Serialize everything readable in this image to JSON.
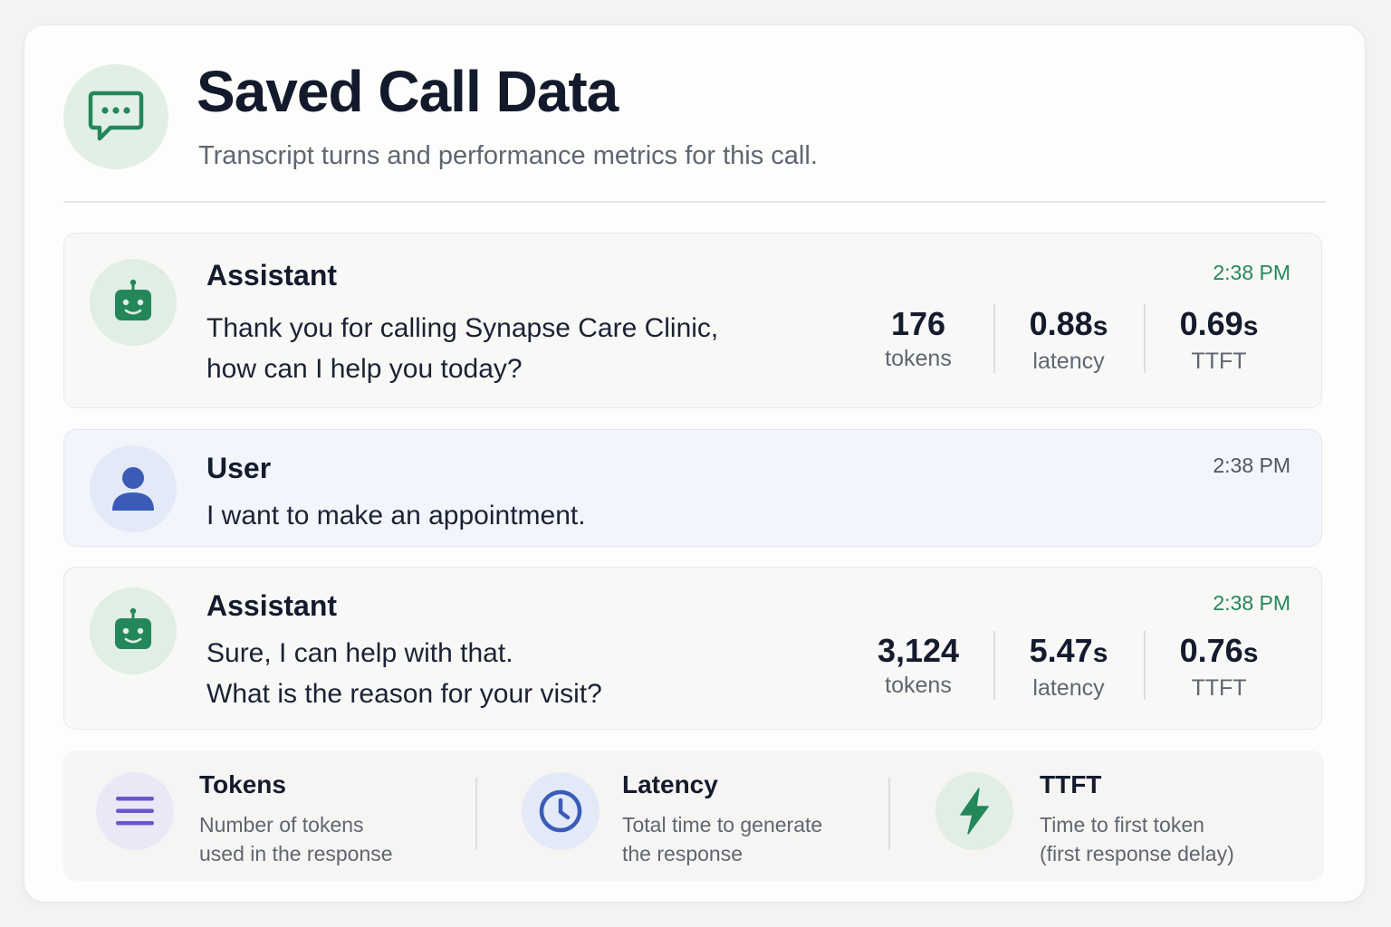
{
  "header": {
    "title": "Saved Call Data",
    "subtitle": "Transcript turns and performance metrics for this call.",
    "icon": "chat-bubble-icon"
  },
  "colors": {
    "accent_green": "#23875a",
    "user_blue": "#3a5cb8",
    "tokens_purple": "#6a57c9"
  },
  "turns": [
    {
      "role": "Assistant",
      "time": "2:38 PM",
      "lines": [
        "Thank you for calling Synapse Care Clinic,",
        "how can I help you today?"
      ],
      "metrics": {
        "tokens": "176",
        "tokens_label": "tokens",
        "latency": "0.88",
        "latency_unit": "s",
        "latency_label": "latency",
        "ttft": "0.69",
        "ttft_unit": "s",
        "ttft_label": "TTFT"
      }
    },
    {
      "role": "User",
      "time": "2:38 PM",
      "lines": [
        "I want to make an appointment."
      ]
    },
    {
      "role": "Assistant",
      "time": "2:38 PM",
      "lines": [
        "Sure, I can help with that.",
        "What is the reason for your visit?"
      ],
      "metrics": {
        "tokens": "3,124",
        "tokens_label": "tokens",
        "latency": "5.47",
        "latency_unit": "s",
        "latency_label": "latency",
        "ttft": "0.76",
        "ttft_unit": "s",
        "ttft_label": "TTFT"
      }
    }
  ],
  "legend": [
    {
      "title": "Tokens",
      "desc1": "Number of tokens",
      "desc2": "used in the response",
      "icon": "list-lines-icon"
    },
    {
      "title": "Latency",
      "desc1": "Total time to generate",
      "desc2": "the response",
      "icon": "clock-icon"
    },
    {
      "title": "TTFT",
      "desc1": "Time to first token",
      "desc2": "(first response delay)",
      "icon": "lightning-bolt-icon"
    }
  ]
}
